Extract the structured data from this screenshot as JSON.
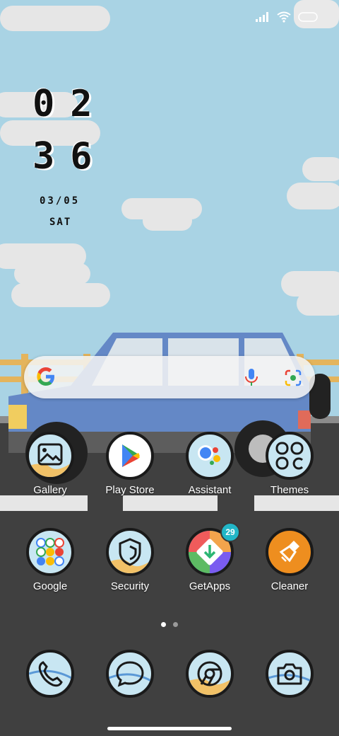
{
  "status_bar": {
    "signal_icon": "signal-icon",
    "wifi_icon": "wifi-icon",
    "battery_icon": "battery-icon"
  },
  "clock": {
    "hours": "02",
    "minutes": "36",
    "date": "03/05",
    "day": "SAT"
  },
  "search_bar": {
    "google_logo": "google-logo",
    "mic_icon": "mic-icon",
    "lens_icon": "lens-icon"
  },
  "apps_row1": [
    {
      "label": "Gallery",
      "icon": "gallery-icon"
    },
    {
      "label": "Play Store",
      "icon": "play-store-icon"
    },
    {
      "label": "Assistant",
      "icon": "assistant-icon"
    },
    {
      "label": "Themes",
      "icon": "themes-icon"
    }
  ],
  "apps_row2": [
    {
      "label": "Google",
      "icon": "google-folder-icon"
    },
    {
      "label": "Security",
      "icon": "security-icon"
    },
    {
      "label": "GetApps",
      "icon": "getapps-icon",
      "badge": "29"
    },
    {
      "label": "Cleaner",
      "icon": "cleaner-icon"
    }
  ],
  "dock": [
    {
      "icon": "phone-icon"
    },
    {
      "icon": "messages-icon"
    },
    {
      "icon": "chrome-icon"
    },
    {
      "icon": "camera-icon"
    }
  ],
  "page_indicator": {
    "pages": 2,
    "active": 0
  },
  "colors": {
    "sky": "#a9d3e4",
    "road": "#404040",
    "car": "#6488c6",
    "icon_bg": "#c8e6f2",
    "cleaner": "#ee8e1f"
  }
}
